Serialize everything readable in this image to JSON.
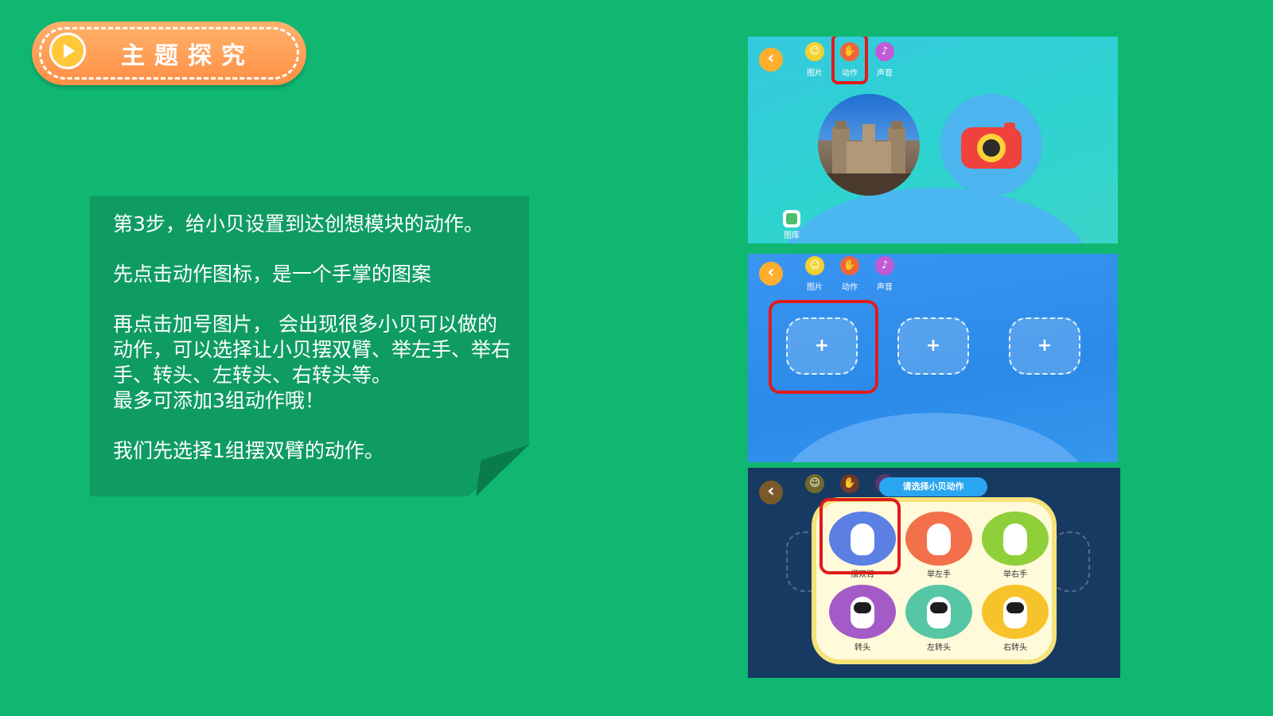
{
  "header": {
    "title": "主题探究"
  },
  "note": {
    "lines": [
      "第3步，给小贝设置到达创想模块的动作。",
      "先点击动作图标，是一个手掌的图案",
      "再点击加号图片， 会出现很多小贝可以做的动作，可以选择让小贝摆双臂、举左手、举右手、转头、左转头、右转头等。",
      "最多可添加3组动作哦！",
      "我们先选择1组摆双臂的动作。"
    ]
  },
  "app": {
    "back_glyph": "‹",
    "tabs": [
      {
        "label": "图片",
        "icon": "smiley-icon"
      },
      {
        "label": "动作",
        "icon": "hand-icon"
      },
      {
        "label": "声音",
        "icon": "sound-icon"
      }
    ],
    "gallery_label": "图库",
    "plus_glyph": "+",
    "dialog_title": "请选择小贝动作",
    "actions": [
      {
        "label": "摆双臂",
        "color": "#5b7fe3"
      },
      {
        "label": "举左手",
        "color": "#f2704a"
      },
      {
        "label": "举右手",
        "color": "#8fcf3a"
      },
      {
        "label": "转头",
        "color": "#a45bc8"
      },
      {
        "label": "左转头",
        "color": "#56c6a5"
      },
      {
        "label": "右转头",
        "color": "#f7c32a"
      }
    ]
  },
  "colors": {
    "background": "#10b771",
    "badge": "#ff9a52",
    "highlight": "#e01b1b"
  }
}
